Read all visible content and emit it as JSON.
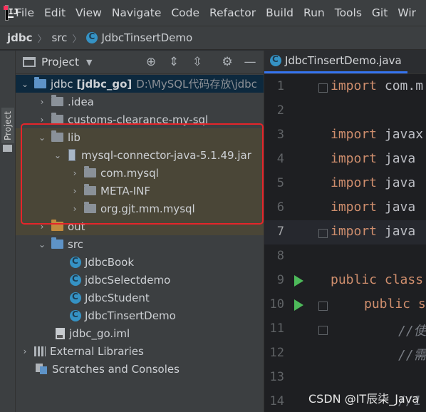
{
  "menu": {
    "items": [
      "File",
      "Edit",
      "View",
      "Navigate",
      "Code",
      "Refactor",
      "Build",
      "Run",
      "Tools",
      "Git",
      "Wir"
    ]
  },
  "breadcrumb": {
    "project": "jdbc",
    "folder": "src",
    "file": "JdbcTinsertDemo"
  },
  "left_stripe": {
    "label": "Project"
  },
  "project_panel": {
    "title": "Project",
    "tree": {
      "root_name": "jdbc",
      "root_module": "[jdbc_go]",
      "root_path": "D:\\MySQL代码存放\\jdbc",
      "idea": ".idea",
      "customs": "customs-clearance-my-sql",
      "lib": "lib",
      "jar": "mysql-connector-java-5.1.49.jar",
      "com_mysql": "com.mysql",
      "meta_inf": "META-INF",
      "org_gjt": "org.gjt.mm.mysql",
      "out": "out",
      "src": "src",
      "class1": "JdbcBook",
      "class2": "jdbcSelectdemo",
      "class3": "JdbcStudent",
      "class4": "JdbcTinsertDemo",
      "iml": "jdbc_go.iml",
      "ext_libs": "External Libraries",
      "scratches": "Scratches and Consoles"
    }
  },
  "editor": {
    "tab": "JdbcTinsertDemo.java",
    "lines": [
      {
        "no": "1",
        "kw": "import",
        "rest": " com.m"
      },
      {
        "no": "2",
        "kw": "",
        "rest": ""
      },
      {
        "no": "3",
        "kw": "import",
        "rest": " javax"
      },
      {
        "no": "4",
        "kw": "import",
        "rest": " java"
      },
      {
        "no": "5",
        "kw": "import",
        "rest": " java"
      },
      {
        "no": "6",
        "kw": "import",
        "rest": " java"
      },
      {
        "no": "7",
        "kw": "import",
        "rest": " java"
      },
      {
        "no": "8",
        "kw": "",
        "rest": ""
      },
      {
        "no": "9",
        "kw": "public",
        "rest": " class"
      },
      {
        "no": "10",
        "kw": "public",
        "rest": " s"
      },
      {
        "no": "11",
        "kw": "",
        "rest": "//使"
      },
      {
        "no": "12",
        "kw": "",
        "rest": "//需"
      },
      {
        "no": "13",
        "kw": "",
        "rest": ""
      },
      {
        "no": "14",
        "kw": "",
        "rest": "//1"
      }
    ]
  },
  "watermark": "CSDN @IT辰柒_Java",
  "colors": {
    "accent": "#3574f0",
    "highlight": "#e5252a",
    "run": "#4dba5a",
    "keyword": "#cf8e6d"
  }
}
